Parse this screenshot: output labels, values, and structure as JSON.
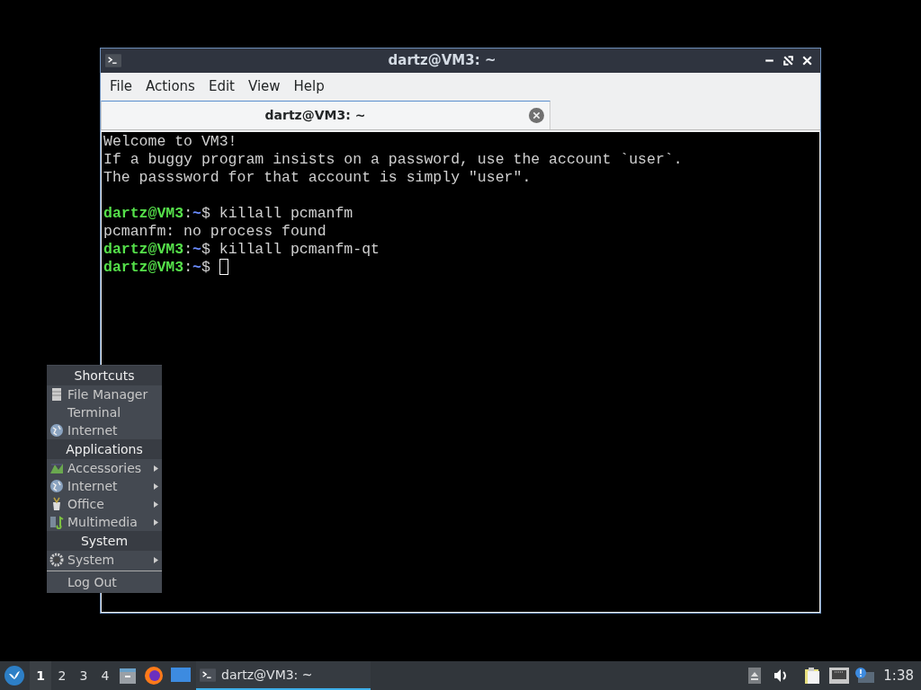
{
  "window": {
    "title": "dartz@VM3: ~",
    "menu": [
      "File",
      "Actions",
      "Edit",
      "View",
      "Help"
    ],
    "tabs": [
      {
        "label": "dartz@VM3: ~",
        "selected": true
      }
    ],
    "terminal": {
      "blocks": [
        [
          {
            "kind": "text",
            "text": "Welcome to VM3!"
          },
          {
            "kind": "text",
            "text": "If a buggy program insists on a password, use the account `user`."
          },
          {
            "kind": "text",
            "text": "The passsword for that account is simply \"user\"."
          }
        ],
        [
          {
            "kind": "prompt",
            "user": "dartz@VM3",
            "sep": ":",
            "path": "~",
            "command": "$ killall pcmanfm",
            "cursor": false
          },
          {
            "kind": "text",
            "text": "pcmanfm: no process found"
          },
          {
            "kind": "prompt",
            "user": "dartz@VM3",
            "sep": ":",
            "path": "~",
            "command": "$ killall pcmanfm-qt",
            "cursor": false
          },
          {
            "kind": "prompt",
            "user": "dartz@VM3",
            "sep": ":",
            "path": "~",
            "command": "$",
            "cursor": true
          }
        ]
      ]
    }
  },
  "start_menu": [
    {
      "kind": "header",
      "label": "Shortcuts"
    },
    {
      "kind": "item",
      "label": "File Manager",
      "submenu": false,
      "divider_before": false
    },
    {
      "kind": "item",
      "label": "Terminal",
      "submenu": false,
      "divider_before": false
    },
    {
      "kind": "item",
      "label": "Internet",
      "submenu": false,
      "divider_before": false
    },
    {
      "kind": "header",
      "label": "Applications"
    },
    {
      "kind": "item",
      "label": "Accessories",
      "submenu": true,
      "divider_before": false
    },
    {
      "kind": "item",
      "label": "Internet",
      "submenu": true,
      "divider_before": false
    },
    {
      "kind": "item",
      "label": "Office",
      "submenu": true,
      "divider_before": false
    },
    {
      "kind": "item",
      "label": "Multimedia",
      "submenu": true,
      "divider_before": false
    },
    {
      "kind": "header",
      "label": "System"
    },
    {
      "kind": "item",
      "label": "System",
      "submenu": true,
      "divider_before": false
    },
    {
      "kind": "item",
      "label": "Log Out",
      "submenu": false,
      "divider_before": true
    }
  ],
  "taskbar": {
    "workspaces": [
      {
        "label": "1",
        "selected": true
      },
      {
        "label": "2",
        "selected": false
      },
      {
        "label": "3",
        "selected": false
      },
      {
        "label": "4",
        "selected": false
      }
    ],
    "tasks": [
      {
        "label": "dartz@VM3: ~",
        "selected": true
      }
    ],
    "clock": "1:38"
  }
}
